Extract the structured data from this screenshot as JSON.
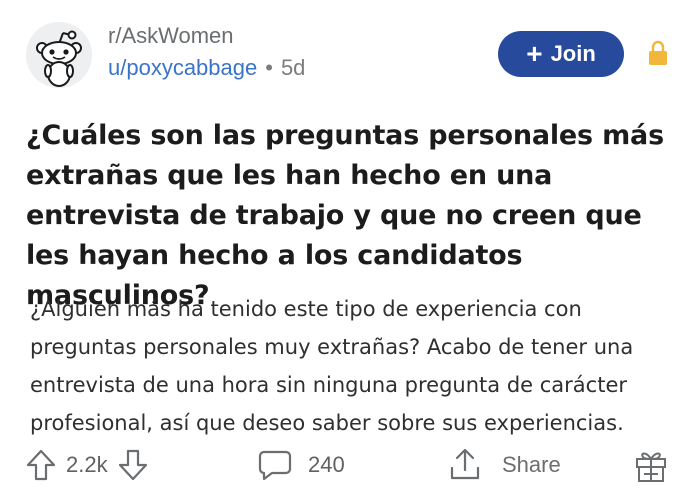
{
  "post": {
    "subreddit": "r/AskWomen",
    "username": "u/poxycabbage",
    "separator": "•",
    "age": "5d",
    "title": "¿Cuáles son las preguntas personales más extrañas que les han hecho en una entrevista de trabajo y que no creen que les hayan hecho a los candidatos masculinos?",
    "body": "¿Alguien más ha tenido este tipo de experiencia con preguntas personales muy extrañas? Acabo de tener una entrevista de una hora sin ninguna pregunta de carácter profesional, así que deseo saber sobre sus experiencias."
  },
  "header": {
    "join_label": "Join",
    "join_icon": "plus-icon",
    "lock_icon": "lock-icon"
  },
  "actions": {
    "vote_count": "2.2k",
    "comment_count": "240",
    "share_label": "Share"
  },
  "colors": {
    "join_bg": "#274a9c",
    "username": "#3a74c9",
    "lock": "#f0b73a",
    "muted": "#6b6e70"
  }
}
